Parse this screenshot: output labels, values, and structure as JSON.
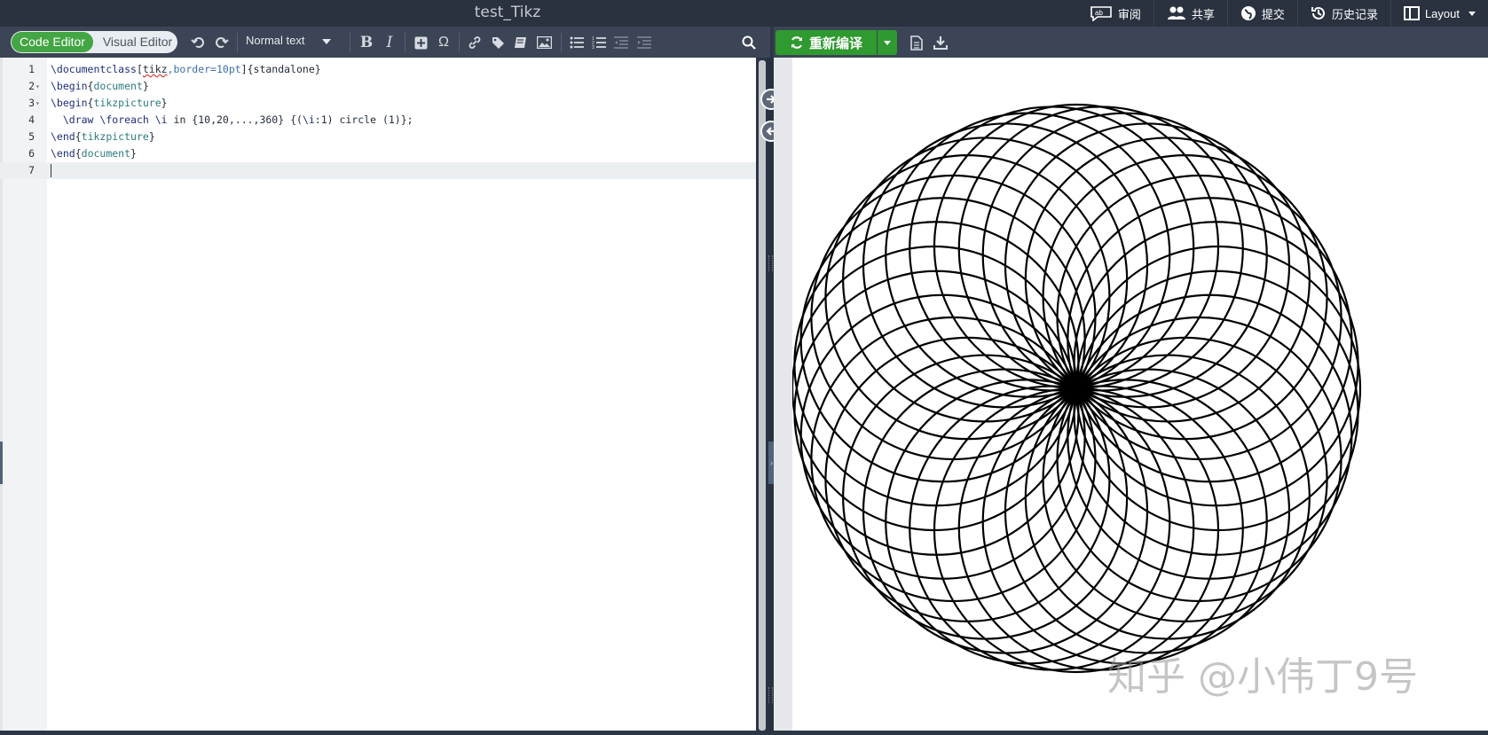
{
  "window": {
    "title": "test_Tikz"
  },
  "topmenu": {
    "review": "审阅",
    "share": "共享",
    "submit": "提交",
    "history": "历史记录",
    "layout": "Layout"
  },
  "toolbar": {
    "code_editor": "Code Editor",
    "visual_editor": "Visual Editor",
    "style_select": "Normal text",
    "bold": "B",
    "italic": "I",
    "omega": "Ω"
  },
  "preview_toolbar": {
    "recompile": "重新编译"
  },
  "editor": {
    "lines": [
      {
        "num": "1",
        "parts": [
          [
            "kw",
            "\\documentclass"
          ],
          [
            "plain",
            "["
          ],
          [
            "squig",
            "tikz"
          ],
          [
            "opt",
            ",border=10pt"
          ],
          [
            "plain",
            "]{standalone}"
          ]
        ]
      },
      {
        "num": "2",
        "fold": true,
        "parts": [
          [
            "kw",
            "\\begin"
          ],
          [
            "plain",
            "{"
          ],
          [
            "arg",
            "document"
          ],
          [
            "plain",
            "}"
          ]
        ]
      },
      {
        "num": "3",
        "fold": true,
        "parts": [
          [
            "kw",
            "\\begin"
          ],
          [
            "plain",
            "{"
          ],
          [
            "arg",
            "tikzpicture"
          ],
          [
            "plain",
            "}"
          ]
        ]
      },
      {
        "num": "4",
        "parts": [
          [
            "plain",
            "  "
          ],
          [
            "kw",
            "\\draw"
          ],
          [
            "plain",
            " "
          ],
          [
            "kw",
            "\\foreach"
          ],
          [
            "plain",
            " "
          ],
          [
            "kw",
            "\\i"
          ],
          [
            "plain",
            " in {10,20,...,360} {("
          ],
          [
            "kw",
            "\\i"
          ],
          [
            "plain",
            ":1) circle (1)};"
          ]
        ]
      },
      {
        "num": "5",
        "parts": [
          [
            "kw",
            "\\end"
          ],
          [
            "plain",
            "{"
          ],
          [
            "arg",
            "tikzpicture"
          ],
          [
            "plain",
            "}"
          ]
        ]
      },
      {
        "num": "6",
        "parts": [
          [
            "kw",
            "\\end"
          ],
          [
            "plain",
            "{"
          ],
          [
            "arg",
            "document"
          ],
          [
            "plain",
            "}"
          ]
        ]
      },
      {
        "num": "7",
        "current": true,
        "parts": []
      }
    ]
  },
  "figure": {
    "circle_count": 36,
    "angle_step_deg": 10
  },
  "watermark": "知乎 @小伟丁9号",
  "colors": {
    "accent_green": "#2f9a2f",
    "toolbar": "#3b4555",
    "topbar": "#2a3240"
  }
}
